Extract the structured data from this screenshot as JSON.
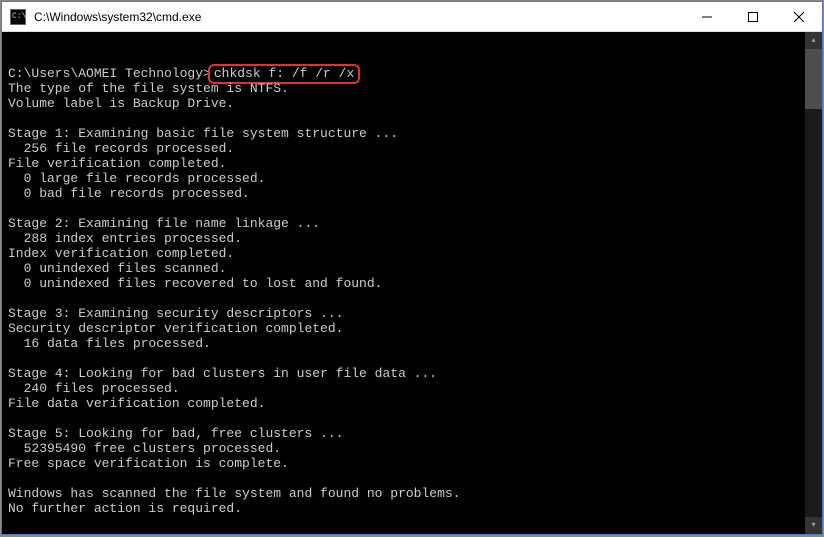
{
  "window": {
    "title": "C:\\Windows\\system32\\cmd.exe",
    "icon_label": "cmd-icon"
  },
  "console": {
    "prompt_path": "C:\\Users\\AOMEI Technology>",
    "command": "chkdsk f: /f /r /x",
    "lines": [
      "The type of the file system is NTFS.",
      "Volume label is Backup Drive.",
      "",
      "Stage 1: Examining basic file system structure ...",
      "  256 file records processed.",
      "File verification completed.",
      "  0 large file records processed.",
      "  0 bad file records processed.",
      "",
      "Stage 2: Examining file name linkage ...",
      "  288 index entries processed.",
      "Index verification completed.",
      "  0 unindexed files scanned.",
      "  0 unindexed files recovered to lost and found.",
      "",
      "Stage 3: Examining security descriptors ...",
      "Security descriptor verification completed.",
      "  16 data files processed.",
      "",
      "Stage 4: Looking for bad clusters in user file data ...",
      "  240 files processed.",
      "File data verification completed.",
      "",
      "Stage 5: Looking for bad, free clusters ...",
      "  52395490 free clusters processed.",
      "Free space verification is complete.",
      "",
      "Windows has scanned the file system and found no problems.",
      "No further action is required."
    ]
  }
}
